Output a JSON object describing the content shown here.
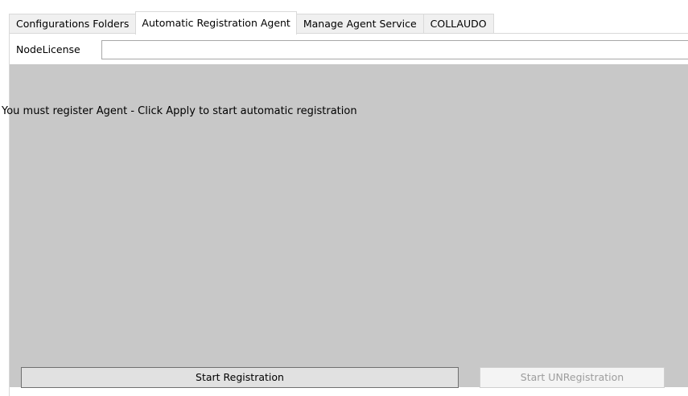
{
  "tabs": [
    {
      "label": "Configurations Folders",
      "active": false
    },
    {
      "label": "Automatic Registration Agent",
      "active": true
    },
    {
      "label": "Manage Agent Service",
      "active": false
    },
    {
      "label": "COLLAUDO",
      "active": false
    }
  ],
  "license": {
    "label": "NodeLicense",
    "value": ""
  },
  "message": "You must register Agent - Click Apply to start automatic registration",
  "buttons": {
    "start_registration": "Start Registration",
    "start_unregistration": "Start UNRegistration"
  },
  "colors": {
    "content_background": "#c8c8c8",
    "disabled_text": "#9d9d9d"
  }
}
